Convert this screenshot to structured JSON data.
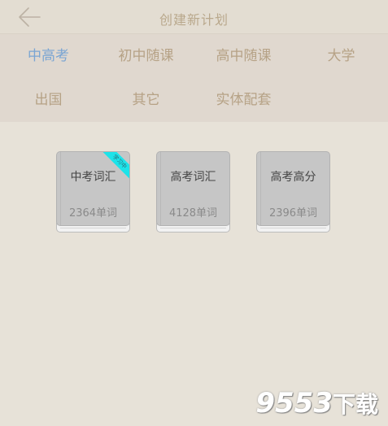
{
  "header": {
    "title": "创建新计划",
    "back_icon": "arrow-left-icon"
  },
  "tabs": [
    {
      "label": "中高考",
      "active": true
    },
    {
      "label": "初中随课",
      "active": false
    },
    {
      "label": "高中随课",
      "active": false
    },
    {
      "label": "大学",
      "active": false
    },
    {
      "label": "出国",
      "active": false
    },
    {
      "label": "其它",
      "active": false
    },
    {
      "label": "实体配套",
      "active": false
    }
  ],
  "books": [
    {
      "title": "中考词汇",
      "count": "2364单词",
      "ribbon": "学习中"
    },
    {
      "title": "高考词汇",
      "count": "4128单词"
    },
    {
      "title": "高考高分",
      "count": "2396单词"
    }
  ],
  "watermark": {
    "number": "9553",
    "suffix": "下载"
  },
  "colors": {
    "background": "#e7e2d8",
    "tab_background": "#e0d8cf",
    "active_tab": "#7aa5d3",
    "inactive_tab": "#b6a286",
    "ribbon": "#1de3e9"
  }
}
